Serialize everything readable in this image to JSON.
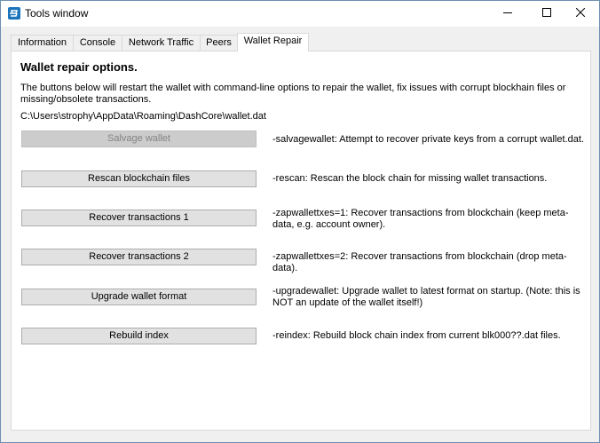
{
  "window": {
    "title": "Tools window",
    "app_icon": "dash-logo-icon",
    "controls": {
      "minimize_icon": "minimize-icon",
      "maximize_icon": "maximize-icon",
      "close_icon": "close-icon"
    }
  },
  "tabs": [
    {
      "label": "Information",
      "active": false
    },
    {
      "label": "Console",
      "active": false
    },
    {
      "label": "Network Traffic",
      "active": false
    },
    {
      "label": "Peers",
      "active": false
    },
    {
      "label": "Wallet Repair",
      "active": true
    }
  ],
  "wallet_repair": {
    "heading": "Wallet repair options.",
    "description": "The buttons below will restart the wallet with command-line options to repair the wallet, fix issues with corrupt blockhain files or missing/obsolete transactions.",
    "wallet_path": "C:\\Users\\strophy\\AppData\\Roaming\\DashCore\\wallet.dat",
    "actions": [
      {
        "label": "Salvage wallet",
        "enabled": false,
        "description": "-salvagewallet: Attempt to recover private keys from a corrupt wallet.dat."
      },
      {
        "label": "Rescan blockchain files",
        "enabled": true,
        "description": "-rescan: Rescan the block chain for missing wallet transactions."
      },
      {
        "label": "Recover transactions 1",
        "enabled": true,
        "description": "-zapwallettxes=1: Recover transactions from blockchain (keep meta-data, e.g. account owner)."
      },
      {
        "label": "Recover transactions 2",
        "enabled": true,
        "description": "-zapwallettxes=2: Recover transactions from blockchain (drop meta-data)."
      },
      {
        "label": "Upgrade wallet format",
        "enabled": true,
        "description": "-upgradewallet: Upgrade wallet to latest format on startup. (Note: this is NOT an update of the wallet itself!)"
      },
      {
        "label": "Rebuild index",
        "enabled": true,
        "description": "-reindex: Rebuild block chain index from current blk000??.dat files."
      }
    ]
  },
  "colors": {
    "accent": "#1c75bc",
    "window_border": "#6f8fb0",
    "disabled_text": "#838383"
  }
}
